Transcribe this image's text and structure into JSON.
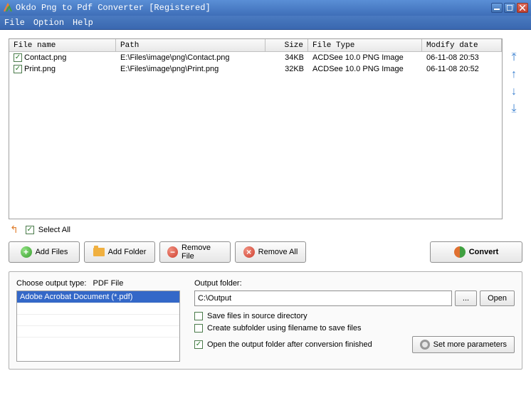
{
  "titlebar": {
    "text": "Okdo Png to Pdf Converter [Registered]"
  },
  "menu": {
    "file": "File",
    "option": "Option",
    "help": "Help"
  },
  "table": {
    "headers": {
      "fname": "File name",
      "path": "Path",
      "size": "Size",
      "type": "File Type",
      "date": "Modify date"
    },
    "rows": [
      {
        "checked": true,
        "fname": "Contact.png",
        "path": "E:\\Files\\image\\png\\Contact.png",
        "size": "34KB",
        "type": "ACDSee 10.0 PNG Image",
        "date": "06-11-08 20:53"
      },
      {
        "checked": true,
        "fname": "Print.png",
        "path": "E:\\Files\\image\\png\\Print.png",
        "size": "32KB",
        "type": "ACDSee 10.0 PNG Image",
        "date": "06-11-08 20:52"
      }
    ]
  },
  "select_all": {
    "label": "Select All",
    "checked": true
  },
  "buttons": {
    "add_files": "Add Files",
    "add_folder": "Add Folder",
    "remove_file": "Remove File",
    "remove_all": "Remove All",
    "convert": "Convert"
  },
  "output_type": {
    "label": "Choose output type:",
    "sublabel": "PDF File",
    "selected": "Adobe Acrobat Document (*.pdf)"
  },
  "output_folder": {
    "label": "Output folder:",
    "value": "C:\\Output",
    "browse": "...",
    "open": "Open"
  },
  "options": {
    "save_in_source": {
      "label": "Save files in source directory",
      "checked": false
    },
    "create_subfolder": {
      "label": "Create subfolder using filename to save files",
      "checked": false
    },
    "open_after": {
      "label": "Open the output folder after conversion finished",
      "checked": true
    }
  },
  "more_params": "Set more parameters"
}
